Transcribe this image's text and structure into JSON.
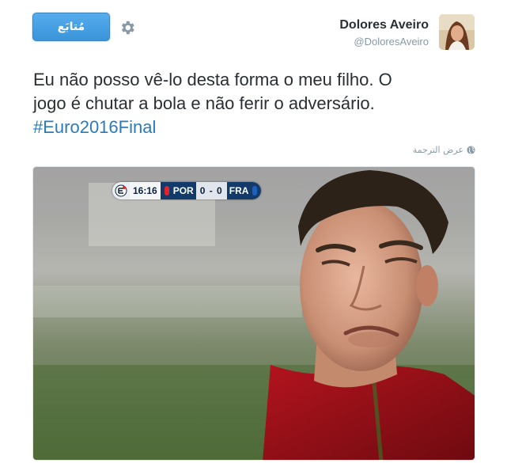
{
  "header": {
    "follow_label": "مُتابَع",
    "display_name": "Dolores Aveiro",
    "handle": "@DoloresAveiro"
  },
  "tweet": {
    "line1": "Eu não posso vê-lo desta forma o meu filho. O",
    "line2": "jogo é chutar a bola e não ferir o adversário.",
    "hashtag": "#Euro2016Final"
  },
  "translate_label": "عرض الترجمة",
  "scoreboard": {
    "time": "16:16",
    "home": "POR",
    "score": "0 - 0",
    "away": "FRA"
  },
  "colors": {
    "accent": "#55acee",
    "hashtag": "#2b7bb9",
    "muted": "#8899a6"
  },
  "icons": {
    "settings": "gear-icon",
    "translate": "globe-icon"
  }
}
